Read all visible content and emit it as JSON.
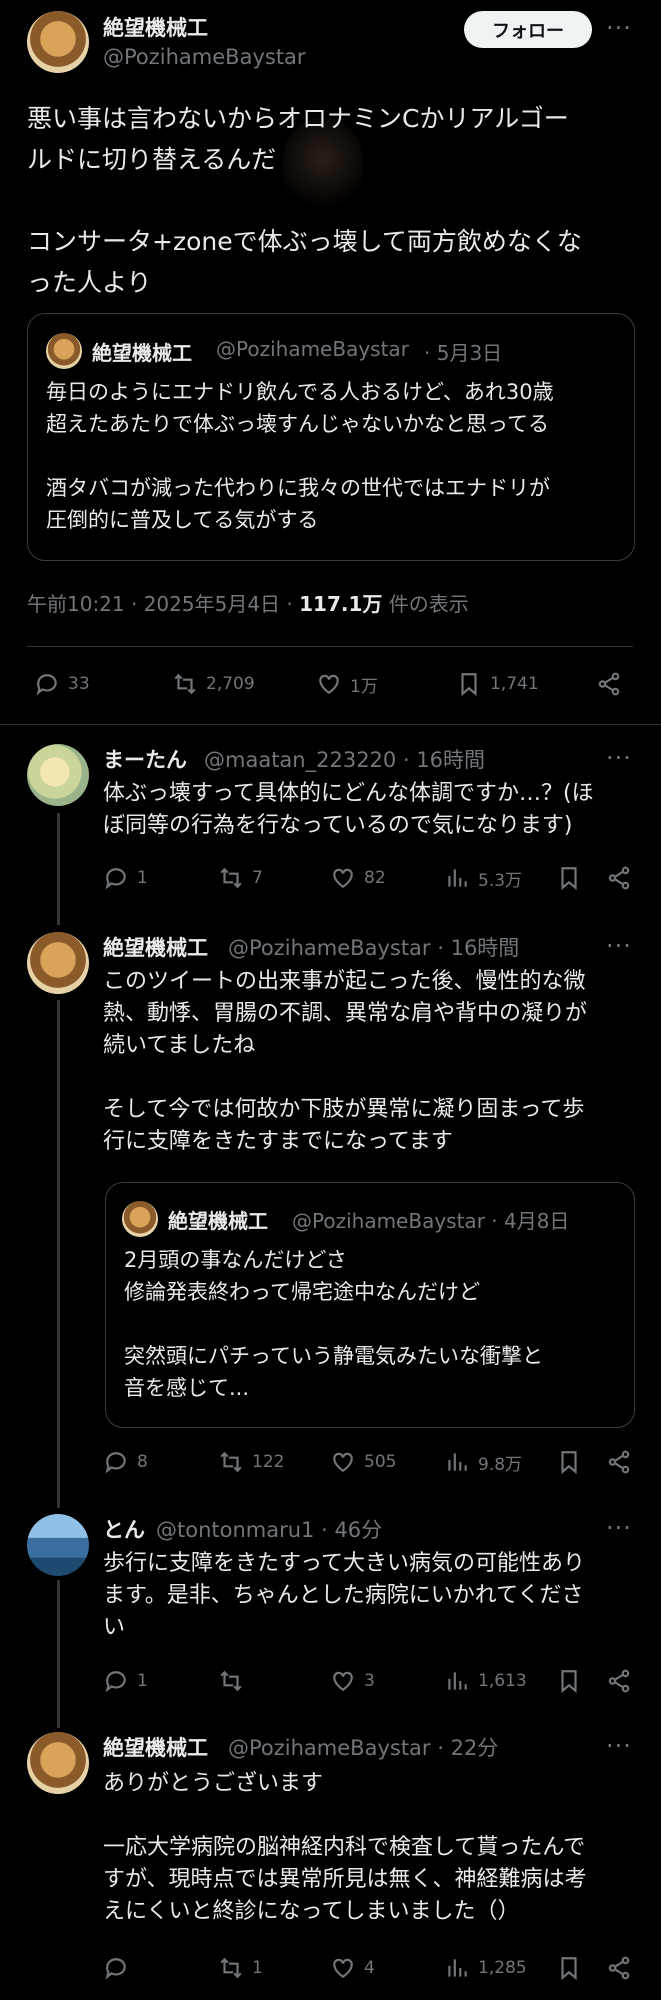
{
  "main_tweet": {
    "author_name": "絶望機械工",
    "author_handle": "@PozihameBaystar",
    "follow_label": "フォロー",
    "more_label": "···",
    "text": "悪い事は言わないからオロナミンCかリアルゴー\nルドに切り替えるんだ\n\nコンサータ+zoneで体ぶっ壊して両方飲めなくな\nった人より",
    "quoted": {
      "author_name": "絶望機械工",
      "author_handle": "@PozihameBaystar",
      "date": "· 5月3日",
      "text": "毎日のようにエナドリ飲んでる人おるけど、あれ30歳\n超えたあたりで体ぶっ壊すんじゃないかなと思ってる\n\n酒タバコが減った代わりに我々の世代ではエナドリが\n圧倒的に普及してる気がする"
    },
    "timestamp": "午前10:21 · 2025年5月4日 · ",
    "views_count": "117.1万",
    "views_label": " 件の表示",
    "actions": {
      "replies": "33",
      "retweets": "2,709",
      "likes": "1万",
      "bookmarks": "1,741"
    }
  },
  "replies": [
    {
      "author_name": "まーたん",
      "author_handle": "@maatan_223220 · 16時間",
      "text": "体ぶっ壊すって具体的にどんな体調ですか…？(ほ\nぼ同等の行為を行なっているので気になります)",
      "actions": {
        "replies": "1",
        "retweets": "7",
        "likes": "82",
        "views": "5.3万"
      }
    },
    {
      "author_name": "絶望機械工",
      "author_handle": "@PozihameBaystar · 16時間",
      "text": "このツイートの出来事が起こった後、慢性的な微\n熱、動悸、胃腸の不調、異常な肩や背中の凝りが\n続いてましたね\n\nそして今では何故か下肢が異常に凝り固まって歩\n行に支障をきたすまでになってます",
      "quoted": {
        "author_name": "絶望機械工",
        "author_handle": "@PozihameBaystar · 4月8日",
        "text": "2月頭の事なんだけどさ\n修論発表終わって帰宅途中なんだけど\n\n突然頭にパチっていう静電気みたいな衝撃と\n音を感じて..."
      },
      "actions": {
        "replies": "8",
        "retweets": "122",
        "likes": "505",
        "views": "9.8万"
      }
    },
    {
      "author_name": "とん",
      "author_handle": "@tontonmaru1 · 46分",
      "text": "歩行に支障をきたすって大きい病気の可能性あり\nます。是非、ちゃんとした病院にいかれてくださ\nい",
      "actions": {
        "replies": "1",
        "retweets": "",
        "likes": "3",
        "views": "1,613"
      }
    },
    {
      "author_name": "絶望機械工",
      "author_handle": "@PozihameBaystar · 22分",
      "text": "ありがとうございます\n\n一応大学病院の脳神経内科で検査して貰ったんで\nすが、現時点では異常所見は無く、神経難病は考\nえにくいと終診になってしまいました（）",
      "actions": {
        "replies": "",
        "retweets": "1",
        "likes": "4",
        "views": "1,285"
      }
    }
  ]
}
